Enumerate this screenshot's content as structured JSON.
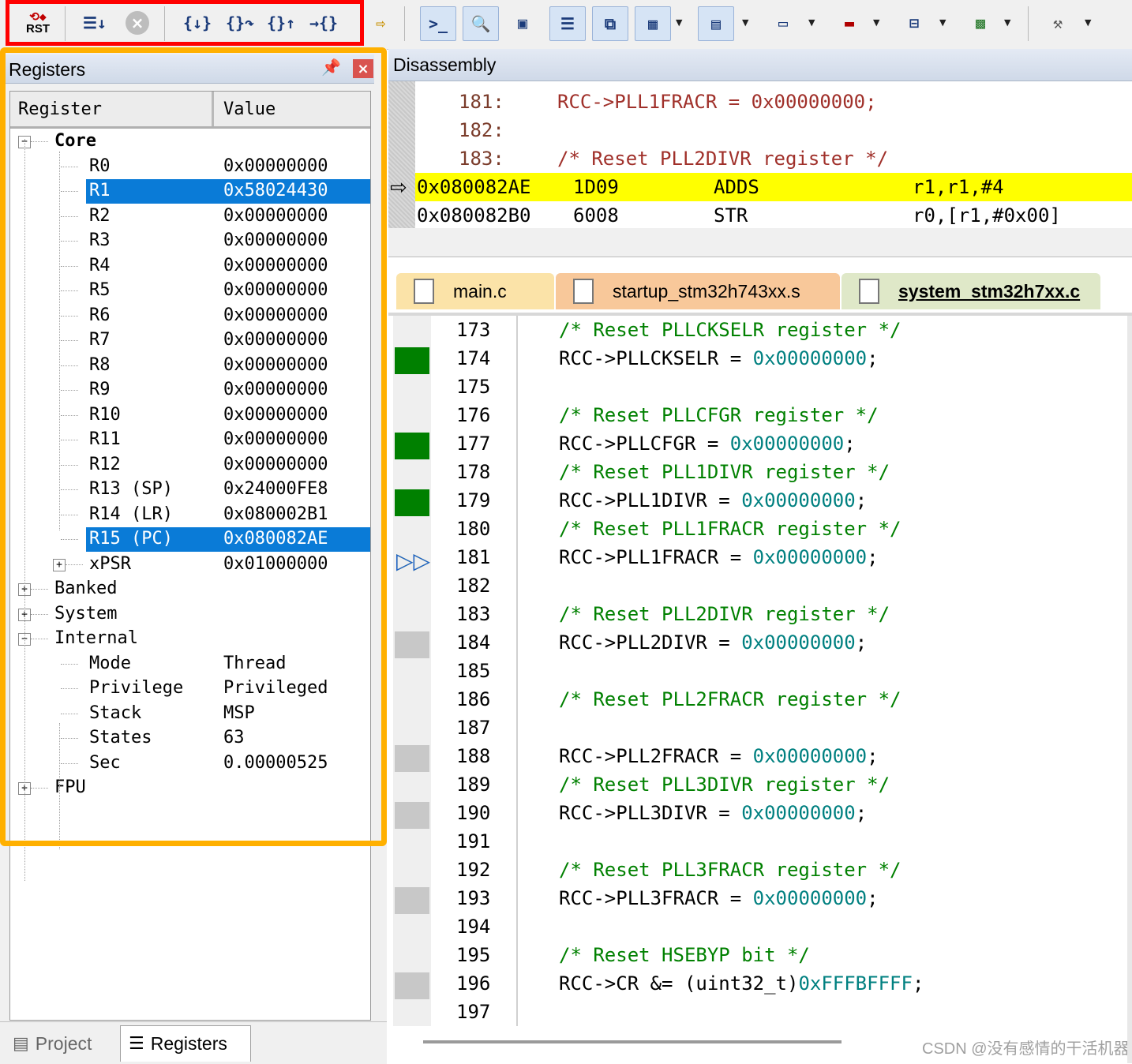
{
  "toolbar": {
    "debug_group": [
      "RST",
      "step-icon",
      "stop-icon",
      "{}",
      "{}",
      "{}",
      "{}"
    ],
    "rst_label": "RST",
    "stop_glyph": "×",
    "step_in": "{↓}",
    "step_over": "{}↷",
    "step_out": "{}↑",
    "run_to_cursor": "→{}"
  },
  "registers_panel": {
    "title": "Registers",
    "col_register": "Register",
    "col_value": "Value",
    "rows": [
      {
        "name": "Core",
        "value": ""
      },
      {
        "name": "R0",
        "value": "0x00000000"
      },
      {
        "name": "R1",
        "value": "0x58024430"
      },
      {
        "name": "R2",
        "value": "0x00000000"
      },
      {
        "name": "R3",
        "value": "0x00000000"
      },
      {
        "name": "R4",
        "value": "0x00000000"
      },
      {
        "name": "R5",
        "value": "0x00000000"
      },
      {
        "name": "R6",
        "value": "0x00000000"
      },
      {
        "name": "R7",
        "value": "0x00000000"
      },
      {
        "name": "R8",
        "value": "0x00000000"
      },
      {
        "name": "R9",
        "value": "0x00000000"
      },
      {
        "name": "R10",
        "value": "0x00000000"
      },
      {
        "name": "R11",
        "value": "0x00000000"
      },
      {
        "name": "R12",
        "value": "0x00000000"
      },
      {
        "name": "R13 (SP)",
        "value": "0x24000FE8"
      },
      {
        "name": "R14 (LR)",
        "value": "0x080002B1"
      },
      {
        "name": "R15 (PC)",
        "value": "0x080082AE"
      },
      {
        "name": "xPSR",
        "value": "0x01000000"
      },
      {
        "name": "Banked",
        "value": ""
      },
      {
        "name": "System",
        "value": ""
      },
      {
        "name": "Internal",
        "value": ""
      },
      {
        "name": "Mode",
        "value": "Thread"
      },
      {
        "name": "Privilege",
        "value": "Privileged"
      },
      {
        "name": "Stack",
        "value": "MSP"
      },
      {
        "name": "States",
        "value": "63"
      },
      {
        "name": "Sec",
        "value": "0.00000525"
      },
      {
        "name": "FPU",
        "value": ""
      }
    ],
    "tabs": {
      "project": "Project",
      "registers": "Registers"
    }
  },
  "disassembly": {
    "title": "Disassembly",
    "source_lines": [
      {
        "no": "181:",
        "text": "RCC->PLL1FRACR = 0x00000000;"
      },
      {
        "no": "182:",
        "text": ""
      },
      {
        "no": "183:",
        "text": "/* Reset PLL2DIVR register */"
      }
    ],
    "instructions": [
      {
        "addr": "0x080082AE",
        "opcode": "1D09",
        "mnemonic": "ADDS",
        "operands": "r1,r1,#4"
      },
      {
        "addr": "0x080082B0",
        "opcode": "6008",
        "mnemonic": "STR",
        "operands": "r0,[r1,#0x00]"
      }
    ]
  },
  "file_tabs": [
    {
      "label": "main.c"
    },
    {
      "label": "startup_stm32h743xx.s"
    },
    {
      "label": "system_stm32h7xx.c"
    }
  ],
  "editor": {
    "lines": [
      {
        "no": "173",
        "parts": [
          [
            "cmt",
            "/* Reset PLLCKSELR register */"
          ]
        ]
      },
      {
        "no": "174",
        "parts": [
          [
            "txt",
            "RCC->PLLCKSELR = "
          ],
          [
            "num",
            "0x00000000"
          ],
          [
            "txt",
            ";"
          ]
        ]
      },
      {
        "no": "175",
        "parts": []
      },
      {
        "no": "176",
        "parts": [
          [
            "cmt",
            "/* Reset PLLCFGR register */"
          ]
        ]
      },
      {
        "no": "177",
        "parts": [
          [
            "txt",
            "RCC->PLLCFGR = "
          ],
          [
            "num",
            "0x00000000"
          ],
          [
            "txt",
            ";"
          ]
        ]
      },
      {
        "no": "178",
        "parts": [
          [
            "cmt",
            "/* Reset PLL1DIVR register */"
          ]
        ]
      },
      {
        "no": "179",
        "parts": [
          [
            "txt",
            "RCC->PLL1DIVR = "
          ],
          [
            "num",
            "0x00000000"
          ],
          [
            "txt",
            ";"
          ]
        ]
      },
      {
        "no": "180",
        "parts": [
          [
            "cmt",
            "/* Reset PLL1FRACR register */"
          ]
        ]
      },
      {
        "no": "181",
        "parts": [
          [
            "txt",
            "RCC->PLL1FRACR = "
          ],
          [
            "num",
            "0x00000000"
          ],
          [
            "txt",
            ";"
          ]
        ]
      },
      {
        "no": "182",
        "parts": []
      },
      {
        "no": "183",
        "parts": [
          [
            "cmt",
            "/* Reset PLL2DIVR register */"
          ]
        ]
      },
      {
        "no": "184",
        "parts": [
          [
            "txt",
            "RCC->PLL2DIVR = "
          ],
          [
            "num",
            "0x00000000"
          ],
          [
            "txt",
            ";"
          ]
        ]
      },
      {
        "no": "185",
        "parts": []
      },
      {
        "no": "186",
        "parts": [
          [
            "cmt",
            "/* Reset PLL2FRACR register */"
          ]
        ]
      },
      {
        "no": "187",
        "parts": []
      },
      {
        "no": "188",
        "parts": [
          [
            "txt",
            "RCC->PLL2FRACR = "
          ],
          [
            "num",
            "0x00000000"
          ],
          [
            "txt",
            ";"
          ]
        ]
      },
      {
        "no": "189",
        "parts": [
          [
            "cmt",
            "/* Reset PLL3DIVR register */"
          ]
        ]
      },
      {
        "no": "190",
        "parts": [
          [
            "txt",
            "RCC->PLL3DIVR = "
          ],
          [
            "num",
            "0x00000000"
          ],
          [
            "txt",
            ";"
          ]
        ]
      },
      {
        "no": "191",
        "parts": []
      },
      {
        "no": "192",
        "parts": [
          [
            "cmt",
            "/* Reset PLL3FRACR register */"
          ]
        ]
      },
      {
        "no": "193",
        "parts": [
          [
            "txt",
            "RCC->PLL3FRACR = "
          ],
          [
            "num",
            "0x00000000"
          ],
          [
            "txt",
            ";"
          ]
        ]
      },
      {
        "no": "194",
        "parts": []
      },
      {
        "no": "195",
        "parts": [
          [
            "cmt",
            "/* Reset HSEBYP bit */"
          ]
        ]
      },
      {
        "no": "196",
        "parts": [
          [
            "txt",
            "RCC->CR &= (uint32_t)"
          ],
          [
            "num",
            "0xFFFBFFFF"
          ],
          [
            "txt",
            ";"
          ]
        ]
      },
      {
        "no": "197",
        "parts": []
      }
    ],
    "coverage": [
      "none",
      "green",
      "none",
      "none",
      "green",
      "none",
      "green",
      "none",
      "current",
      "none",
      "none",
      "grey",
      "none",
      "none",
      "none",
      "grey",
      "none",
      "grey",
      "none",
      "none",
      "grey",
      "none",
      "none",
      "grey",
      "none"
    ]
  },
  "watermark": "CSDN @没有感情的干活机器",
  "colors": {
    "highlight_outline": "#ffb000",
    "debug_outline": "#ff0000",
    "selection": "#0a7bd7",
    "current_line": "#ffff00",
    "comment": "#008000",
    "number": "#008080"
  }
}
